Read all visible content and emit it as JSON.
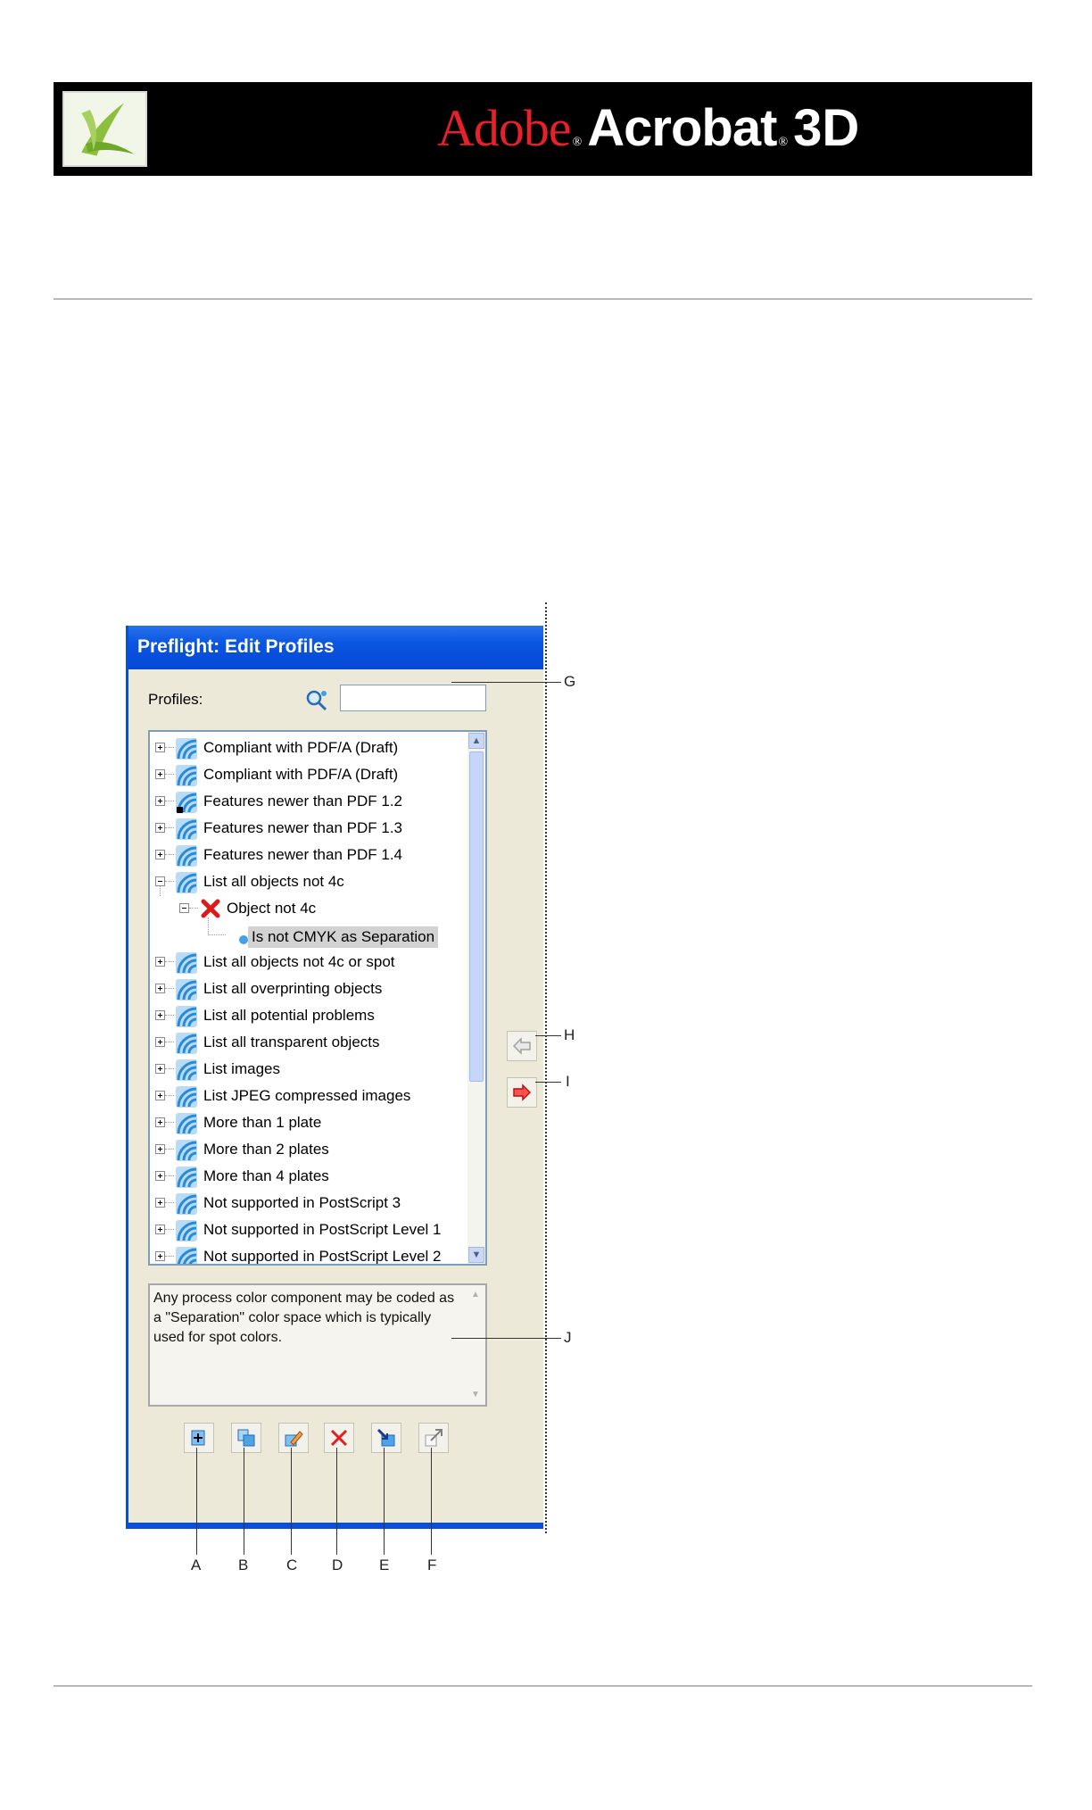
{
  "banner": {
    "adobe": "Adobe",
    "acrobat": "Acrobat",
    "three_d": "3D",
    "registered": "®",
    "colors": {
      "background": "#000000",
      "adobe_red": "#e8202a",
      "text": "#ffffff"
    }
  },
  "dialog": {
    "title": "Preflight: Edit Profiles",
    "profiles_label": "Profiles:",
    "search_value": "",
    "tree": [
      {
        "label": "Compliant with PDF/A (Draft)",
        "level": 0,
        "expander": "plus"
      },
      {
        "label": "Compliant with PDF/A (Draft)",
        "level": 0,
        "expander": "plus"
      },
      {
        "label": "Features newer than PDF 1.2",
        "level": 0,
        "expander": "plus",
        "locked": true
      },
      {
        "label": "Features newer than PDF 1.3",
        "level": 0,
        "expander": "plus"
      },
      {
        "label": "Features newer than PDF 1.4",
        "level": 0,
        "expander": "plus"
      },
      {
        "label": "List all objects not 4c",
        "level": 0,
        "expander": "minus"
      },
      {
        "label": "Object not 4c",
        "level": 1,
        "expander": "minus"
      },
      {
        "label": "Is not CMYK as Separation",
        "level": 2,
        "selected": true
      },
      {
        "label": "List all objects not 4c or spot",
        "level": 0,
        "expander": "plus"
      },
      {
        "label": "List all overprinting objects",
        "level": 0,
        "expander": "plus"
      },
      {
        "label": "List all potential problems",
        "level": 0,
        "expander": "plus"
      },
      {
        "label": "List all transparent objects",
        "level": 0,
        "expander": "plus"
      },
      {
        "label": "List images",
        "level": 0,
        "expander": "plus"
      },
      {
        "label": "List JPEG compressed images",
        "level": 0,
        "expander": "plus"
      },
      {
        "label": "More than 1 plate",
        "level": 0,
        "expander": "plus"
      },
      {
        "label": "More than 2 plates",
        "level": 0,
        "expander": "plus"
      },
      {
        "label": "More than 4 plates",
        "level": 0,
        "expander": "plus"
      },
      {
        "label": "Not supported in PostScript 3",
        "level": 0,
        "expander": "plus"
      },
      {
        "label": "Not supported in PostScript Level 1",
        "level": 0,
        "expander": "plus"
      },
      {
        "label": "Not supported in PostScript Level 2",
        "level": 0,
        "expander": "plus"
      }
    ],
    "description": "Any process color component may be coded as a \"Separation\" color space which is typically used for spot colors.",
    "toolbar_buttons": [
      "new-profile-icon",
      "duplicate-icon",
      "edit-icon",
      "delete-icon",
      "import-icon",
      "export-icon"
    ],
    "side_buttons": [
      "left-arrow-icon",
      "right-arrow-icon"
    ],
    "colors": {
      "titlebar": "#0a56e0",
      "face": "#ece9d8",
      "selected": "#d2d2d2"
    }
  },
  "callouts": {
    "A": "A",
    "B": "B",
    "C": "C",
    "D": "D",
    "E": "E",
    "F": "F",
    "G": "G",
    "H": "H",
    "I": "I",
    "J": "J"
  }
}
